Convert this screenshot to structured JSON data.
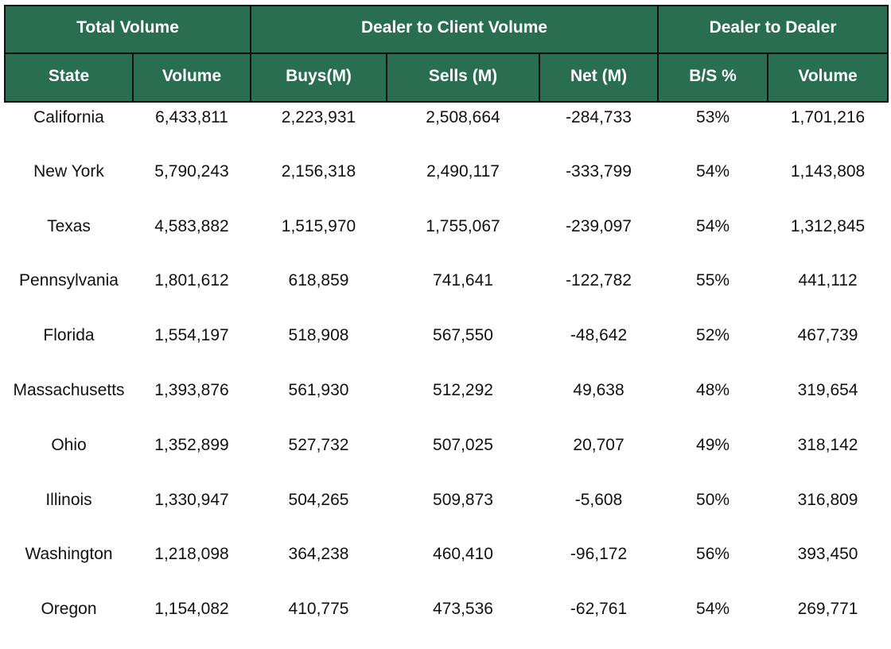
{
  "table": {
    "groups": [
      {
        "label": "Total Volume"
      },
      {
        "label": "Dealer to Client Volume"
      },
      {
        "label": "Dealer to Dealer"
      }
    ],
    "columns": [
      "State",
      "Volume",
      "Buys(M)",
      "Sells (M)",
      "Net (M)",
      "B/S %",
      "Volume"
    ],
    "rows": [
      [
        "California",
        "6,433,811",
        "2,223,931",
        "2,508,664",
        "-284,733",
        "53%",
        "1,701,216"
      ],
      [
        "New York",
        "5,790,243",
        "2,156,318",
        "2,490,117",
        "-333,799",
        "54%",
        "1,143,808"
      ],
      [
        "Texas",
        "4,583,882",
        "1,515,970",
        "1,755,067",
        "-239,097",
        "54%",
        "1,312,845"
      ],
      [
        "Pennsylvania",
        "1,801,612",
        "618,859",
        "741,641",
        "-122,782",
        "55%",
        "441,112"
      ],
      [
        "Florida",
        "1,554,197",
        "518,908",
        "567,550",
        "-48,642",
        "52%",
        "467,739"
      ],
      [
        "Massachusetts",
        "1,393,876",
        "561,930",
        "512,292",
        "49,638",
        "48%",
        "319,654"
      ],
      [
        "Ohio",
        "1,352,899",
        "527,732",
        "507,025",
        "20,707",
        "49%",
        "318,142"
      ],
      [
        "Illinois",
        "1,330,947",
        "504,265",
        "509,873",
        "-5,608",
        "50%",
        "316,809"
      ],
      [
        "Washington",
        "1,218,098",
        "364,238",
        "460,410",
        "-96,172",
        "56%",
        "393,450"
      ],
      [
        "Oregon",
        "1,154,082",
        "410,775",
        "473,536",
        "-62,761",
        "54%",
        "269,771"
      ]
    ]
  },
  "colors": {
    "header_bg": "#2a6e52",
    "header_text": "#ffffff",
    "border": "#111111"
  }
}
